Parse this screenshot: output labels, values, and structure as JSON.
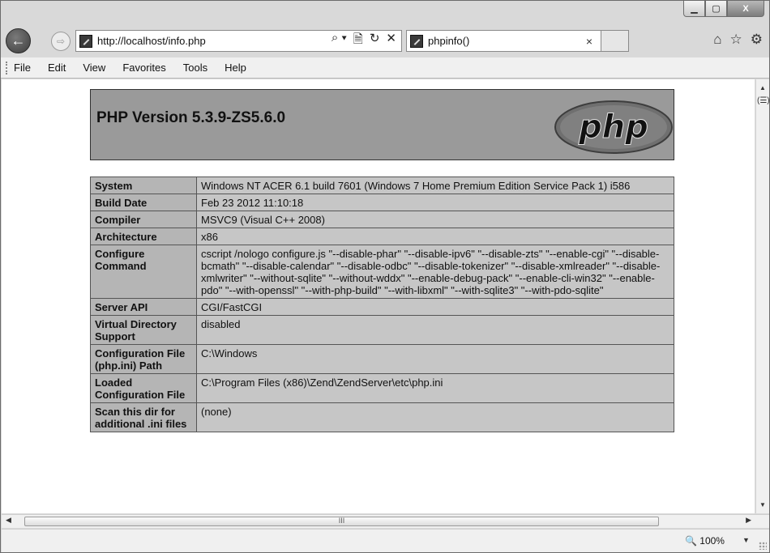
{
  "window": {
    "minimize_glyph": "▁",
    "maximize_glyph": "▢",
    "close_glyph": "X"
  },
  "nav": {
    "back_glyph": "←",
    "forward_glyph": "⇨",
    "address": "http://localhost/info.php",
    "search_glyph": "⌕ ▾",
    "compat_glyph": "🗎",
    "refresh_glyph": "↻",
    "stop_glyph": "✕",
    "tab_title": "phpinfo()",
    "tab_close_glyph": "×",
    "home_glyph": "⌂",
    "favorites_glyph": "☆",
    "tools_glyph": "⚙"
  },
  "menu": [
    "File",
    "Edit",
    "View",
    "Favorites",
    "Tools",
    "Help"
  ],
  "page": {
    "php_version_title": "PHP Version 5.3.9-ZS5.6.0",
    "logo_text": "php",
    "rows": [
      {
        "key": "System",
        "value": "Windows NT ACER 6.1 build 7601 (Windows 7 Home Premium Edition Service Pack 1) i586"
      },
      {
        "key": "Build Date",
        "value": "Feb 23 2012 11:10:18"
      },
      {
        "key": "Compiler",
        "value": "MSVC9 (Visual C++ 2008)"
      },
      {
        "key": "Architecture",
        "value": "x86"
      },
      {
        "key": "Configure Command",
        "value": "cscript /nologo configure.js \"--disable-phar\" \"--disable-ipv6\" \"--disable-zts\" \"--enable-cgi\" \"--disable-bcmath\" \"--disable-calendar\" \"--disable-odbc\" \"--disable-tokenizer\" \"--disable-xmlreader\" \"--disable-xmlwriter\" \"--without-sqlite\" \"--without-wddx\" \"--enable-debug-pack\" \"--enable-cli-win32\" \"--enable-pdo\" \"--with-openssl\" \"--with-php-build\" \"--with-libxml\" \"--with-sqlite3\" \"--with-pdo-sqlite\""
      },
      {
        "key": "Server API",
        "value": "CGI/FastCGI"
      },
      {
        "key": "Virtual Directory Support",
        "value": "disabled"
      },
      {
        "key": "Configuration File (php.ini) Path",
        "value": "C:\\Windows"
      },
      {
        "key": "Loaded Configuration File",
        "value": "C:\\Program Files (x86)\\Zend\\ZendServer\\etc\\php.ini"
      },
      {
        "key": "Scan this dir for additional .ini files",
        "value": "(none)"
      }
    ]
  },
  "scroll": {
    "up_glyph": "▲",
    "down_glyph": "▼",
    "left_glyph": "◀",
    "right_glyph": "▶",
    "thumb_grip": "III",
    "compat_view_glyph": "(☰)"
  },
  "status": {
    "zoom_label": "🔍 100%",
    "zoom_caret": "▼"
  }
}
